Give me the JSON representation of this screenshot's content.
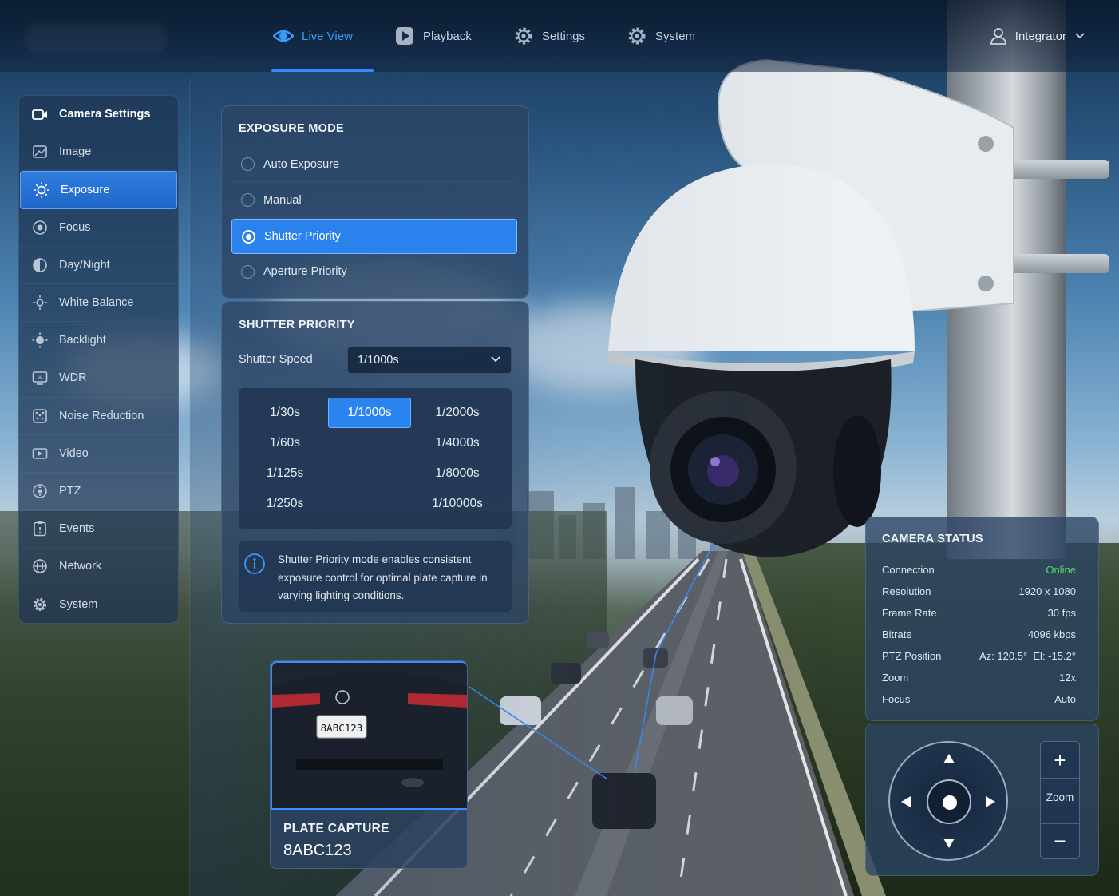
{
  "nav": {
    "items": [
      {
        "label": "Live View",
        "icon": "eye-icon",
        "active": true
      },
      {
        "label": "Playback",
        "icon": "play-icon",
        "active": false
      },
      {
        "label": "Settings",
        "icon": "gear-icon",
        "active": false
      },
      {
        "label": "System",
        "icon": "gear-icon",
        "active": false
      }
    ],
    "user": {
      "label": "Integrator",
      "icon": "user-icon"
    }
  },
  "sidebar": {
    "header": "Camera Settings",
    "items": [
      {
        "label": "Image",
        "icon": "image-icon"
      },
      {
        "label": "Exposure",
        "icon": "sun-icon",
        "active": true
      },
      {
        "label": "Focus",
        "icon": "focus-icon"
      },
      {
        "label": "Day/Night",
        "icon": "day-night-icon"
      },
      {
        "label": "White Balance",
        "icon": "white-balance-icon"
      },
      {
        "label": "Backlight",
        "icon": "backlight-icon"
      },
      {
        "label": "WDR",
        "icon": "wdr-icon"
      },
      {
        "label": "Noise Reduction",
        "icon": "noise-reduction-icon"
      },
      {
        "label": "Video",
        "icon": "video-icon"
      },
      {
        "label": "PTZ",
        "icon": "ptz-icon"
      },
      {
        "label": "Events",
        "icon": "events-icon"
      },
      {
        "label": "Network",
        "icon": "globe-icon"
      },
      {
        "label": "System",
        "icon": "gear-icon"
      }
    ]
  },
  "exposure_mode": {
    "title": "EXPOSURE MODE",
    "options": [
      "Auto Exposure",
      "Manual",
      "Shutter Priority",
      "Aperture Priority"
    ],
    "selected": "Shutter Priority"
  },
  "shutter_priority": {
    "title": "SHUTTER PRIORITY",
    "speed_label": "Shutter Speed",
    "speed_value": "1/1000s",
    "options_left": [
      "1/30s",
      "1/60s",
      "1/125s",
      "1/250s"
    ],
    "option_selected": "1/1000s",
    "options_right": [
      "1/2000s",
      "1/4000s",
      "1/8000s",
      "1/10000s"
    ],
    "info": "Shutter Priority mode enables consistent exposure control for optimal plate capture in varying lighting conditions."
  },
  "plate_capture": {
    "title": "PLATE CAPTURE",
    "plate": "8ABC123"
  },
  "camera_status": {
    "title": "CAMERA STATUS",
    "rows": [
      {
        "label": "Connection",
        "value": "Online"
      },
      {
        "label": "Resolution",
        "value": "1920 x 1080"
      },
      {
        "label": "Frame Rate",
        "value": "30 fps"
      },
      {
        "label": "Bitrate",
        "value": "4096 kbps"
      },
      {
        "label": "PTZ Position",
        "value": "Az: 120.5°  El: -15.2°"
      },
      {
        "label": "Zoom",
        "value": "12x"
      },
      {
        "label": "Focus",
        "value": "Auto"
      }
    ]
  },
  "ptz_control": {
    "zoom_label": "Zoom",
    "zoom_in": "+",
    "zoom_out": "−"
  },
  "colors": {
    "accent": "#2a84f0",
    "online": "#4cd964"
  }
}
